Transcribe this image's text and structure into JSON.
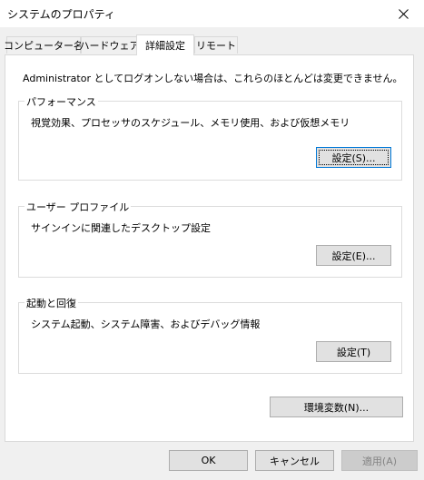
{
  "window": {
    "title": "システムのプロパティ"
  },
  "tabs": [
    {
      "label": "コンピューター名"
    },
    {
      "label": "ハードウェア"
    },
    {
      "label": "詳細設定"
    },
    {
      "label": "リモート"
    }
  ],
  "selected_tab": "詳細設定",
  "intro_text": "Administrator としてログオンしない場合は、これらのほとんどは変更できません。",
  "groups": {
    "performance": {
      "title": "パフォーマンス",
      "description": "視覚効果、プロセッサのスケジュール、メモリ使用、および仮想メモリ",
      "button": "設定(S)..."
    },
    "user_profiles": {
      "title": "ユーザー プロファイル",
      "description": "サインインに関連したデスクトップ設定",
      "button": "設定(E)..."
    },
    "startup_recovery": {
      "title": "起動と回復",
      "description": "システム起動、システム障害、およびデバッグ情報",
      "button": "設定(T)"
    }
  },
  "env_button": "環境変数(N)...",
  "footer": {
    "ok": "OK",
    "cancel": "キャンセル",
    "apply": "適用(A)"
  },
  "colors": {
    "focus_accent": "#0078d7",
    "button_face": "#e1e1e1",
    "dialog_background": "#f0f0f0"
  }
}
